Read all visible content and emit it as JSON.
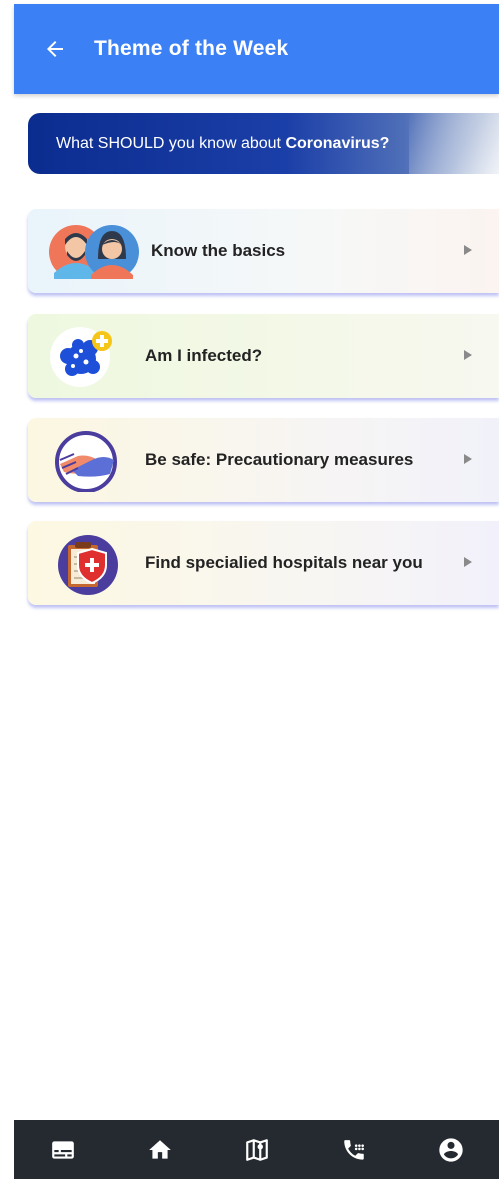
{
  "header": {
    "title": "Theme of the Week",
    "back_icon": "arrow-back-icon",
    "bg_color": "#3c80f6"
  },
  "banner": {
    "text_normal": "What SHOULD you know about ",
    "text_bold": "Coronavirus?"
  },
  "cards": [
    {
      "label": "Know the basics",
      "icon": "people-avatars-icon"
    },
    {
      "label": "Am I infected?",
      "icon": "virus-plus-icon"
    },
    {
      "label": "Be safe: Precautionary measures",
      "icon": "handshake-icon"
    },
    {
      "label": "Find specialied hospitals near you",
      "icon": "hospital-clipboard-icon"
    }
  ],
  "bottom_nav": {
    "bg_color": "#252a30",
    "items": [
      "news-icon",
      "home-icon",
      "map-icon",
      "phone-icon",
      "account-icon"
    ]
  }
}
